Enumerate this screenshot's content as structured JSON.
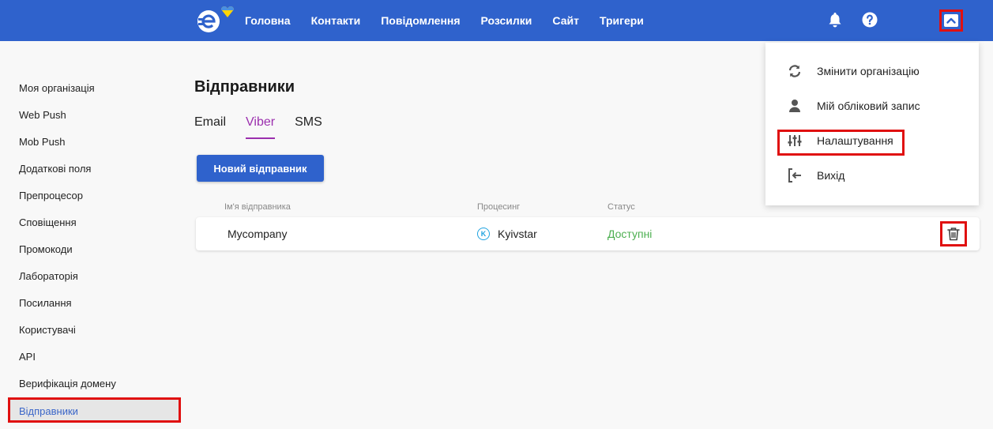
{
  "header": {
    "logo_icon": "e-logo-icon",
    "nav": [
      "Головна",
      "Контакти",
      "Повідомлення",
      "Розсилки",
      "Сайт",
      "Тригери"
    ],
    "bell_icon": "bell-icon",
    "help_icon": "question-icon",
    "collapse_icon": "chevron-up-icon"
  },
  "sidebar": {
    "items": [
      "Моя організація",
      "Web Push",
      "Mob Push",
      "Додаткові поля",
      "Препроцесор",
      "Сповіщення",
      "Промокоди",
      "Лабораторія",
      "Посилання",
      "Користувачі",
      "API",
      "Верифікація домену",
      "Відправники"
    ],
    "active": "Відправники"
  },
  "main": {
    "title": "Відправники",
    "tabs": [
      "Email",
      "Viber",
      "SMS"
    ],
    "active_tab": "Viber",
    "new_button": "Новий відправник",
    "table": {
      "headers": [
        "Ім'я відправника",
        "Процесинг",
        "Статус"
      ],
      "rows": [
        {
          "name": "Mycompany",
          "processing_icon": "K",
          "processing": "Kyivstar",
          "status": "Доступні"
        }
      ]
    }
  },
  "dropdown": {
    "items": [
      {
        "label": "Змінити організацію",
        "icon": "sync-icon"
      },
      {
        "label": "Мій обліковий запис",
        "icon": "user-icon"
      },
      {
        "label": "Налаштування",
        "icon": "sliders-icon"
      },
      {
        "label": "Вихід",
        "icon": "logout-icon"
      }
    ]
  },
  "colors": {
    "brand": "#2f62cc",
    "active_tab": "#9b2fae",
    "status_ok": "#4caf50",
    "highlight": "#e01010"
  }
}
